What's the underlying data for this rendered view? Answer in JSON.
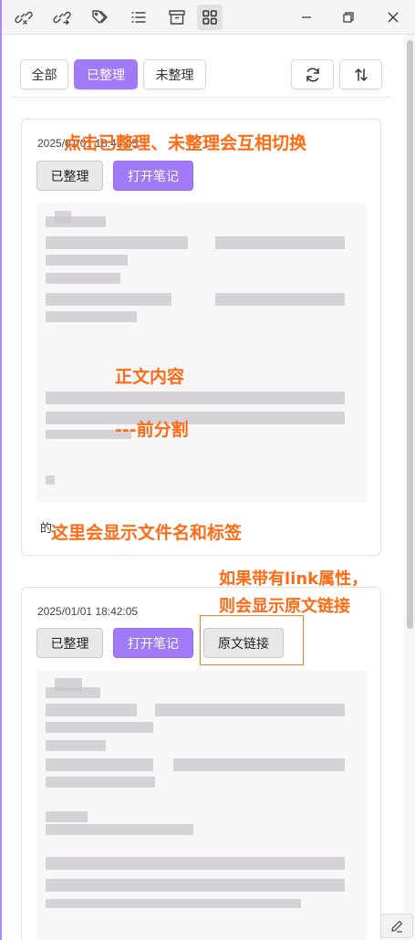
{
  "toolbar": {
    "icons": [
      "unlink-left-icon",
      "unlink-right-icon",
      "tags-icon",
      "list-icon",
      "archive-icon",
      "grid-icon"
    ]
  },
  "filters": {
    "all": "全部",
    "organized": "已整理",
    "unorganized": "未整理"
  },
  "cards": [
    {
      "date": "2025/01/01 18:42:05",
      "buttons": {
        "organized": "已整理",
        "open_note": "打开笔记"
      },
      "footer": "的"
    },
    {
      "date": "2025/01/01 18:42:05",
      "buttons": {
        "organized": "已整理",
        "open_note": "打开笔记",
        "source_link": "原文链接"
      }
    }
  ],
  "annotations": {
    "toggle": "点击已整理、未整理会互相切换",
    "body": "正文内容",
    "divider": "---前分割",
    "filename": "这里会显示文件名和标签",
    "link_line1": "如果带有link属性，",
    "link_line2": "则会显示原文链接"
  },
  "colors": {
    "accent": "#a07af7",
    "annotation": "#ff6b15"
  }
}
